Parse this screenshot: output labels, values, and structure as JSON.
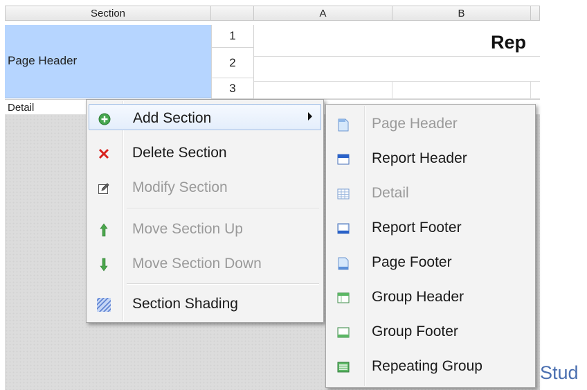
{
  "grid": {
    "columns": {
      "section": "Section",
      "a": "A",
      "b": "B"
    },
    "section_label": "Page Header",
    "row_numbers": [
      "1",
      "2",
      "3"
    ],
    "title_fragment": "Rep",
    "detail_label": "Detail"
  },
  "context_menu": {
    "items": [
      {
        "label": "Add Section",
        "icon": "plus-circle-icon",
        "enabled": true,
        "active": true,
        "submenu": true
      },
      {
        "label": "Delete Section",
        "icon": "red-x-icon",
        "enabled": true
      },
      {
        "label": "Modify Section",
        "icon": "edit-icon",
        "enabled": false
      },
      {
        "label": "Move Section Up",
        "icon": "up-arrow-icon",
        "enabled": false
      },
      {
        "label": "Move Section Down",
        "icon": "down-arrow-icon",
        "enabled": false
      },
      {
        "label": "Section Shading",
        "icon": "shading-icon",
        "enabled": true
      }
    ]
  },
  "submenu": {
    "items": [
      {
        "label": "Page Header",
        "icon": "page-header-icon",
        "enabled": false
      },
      {
        "label": "Report Header",
        "icon": "report-header-icon",
        "enabled": true
      },
      {
        "label": "Detail",
        "icon": "detail-icon",
        "enabled": false
      },
      {
        "label": "Report Footer",
        "icon": "report-footer-icon",
        "enabled": true
      },
      {
        "label": "Page Footer",
        "icon": "page-footer-icon",
        "enabled": true
      },
      {
        "label": "Group Header",
        "icon": "group-header-icon",
        "enabled": true
      },
      {
        "label": "Group Footer",
        "icon": "group-footer-icon",
        "enabled": true
      },
      {
        "label": "Repeating Group",
        "icon": "repeating-group-icon",
        "enabled": true
      }
    ]
  },
  "footer_fragment": "Stud",
  "colors": {
    "section_highlight": "#b6d5ff",
    "accent_blue": "#2a62c9",
    "green": "#3aa14a",
    "red": "#d8201c"
  }
}
